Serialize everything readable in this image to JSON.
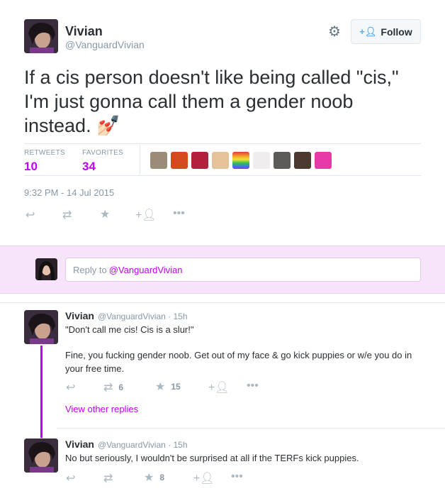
{
  "tweet": {
    "author_name": "Vivian",
    "author_handle": "@VanguardVivian",
    "follow_label": "Follow",
    "text": "If a cis person doesn't like being called \"cis,\" I'm just gonna call them a gender noob instead. 💅🏻",
    "stats": {
      "retweets_label": "RETWEETS",
      "retweets_count": "10",
      "favorites_label": "FAVORITES",
      "favorites_count": "34"
    },
    "timestamp": "9:32 PM - 14 Jul 2015"
  },
  "reply_box": {
    "prefix": "Reply to ",
    "mention": "@VanguardVivian"
  },
  "replies": [
    {
      "name": "Vivian",
      "meta": "@VanguardVivian · 15h",
      "text_line1": "\"Don't call me cis! Cis is a slur!\"",
      "text_line2": "Fine, you fucking gender noob. Get out of my face & go kick puppies or w/e you do in your free time.",
      "retweets": "6",
      "favorites": "15",
      "view_replies": "View other replies"
    },
    {
      "name": "Vivian",
      "meta": "@VanguardVivian · 15h",
      "text_line1": "No but seriously, I wouldn't be surprised at all if the TERFs kick puppies.",
      "favorites": "8"
    }
  ],
  "colors": {
    "accent": "#c200f4",
    "reply_bar_bg": "#f7e3fa",
    "muted": "#8899a6",
    "icon_gray": "#aab8c2"
  }
}
